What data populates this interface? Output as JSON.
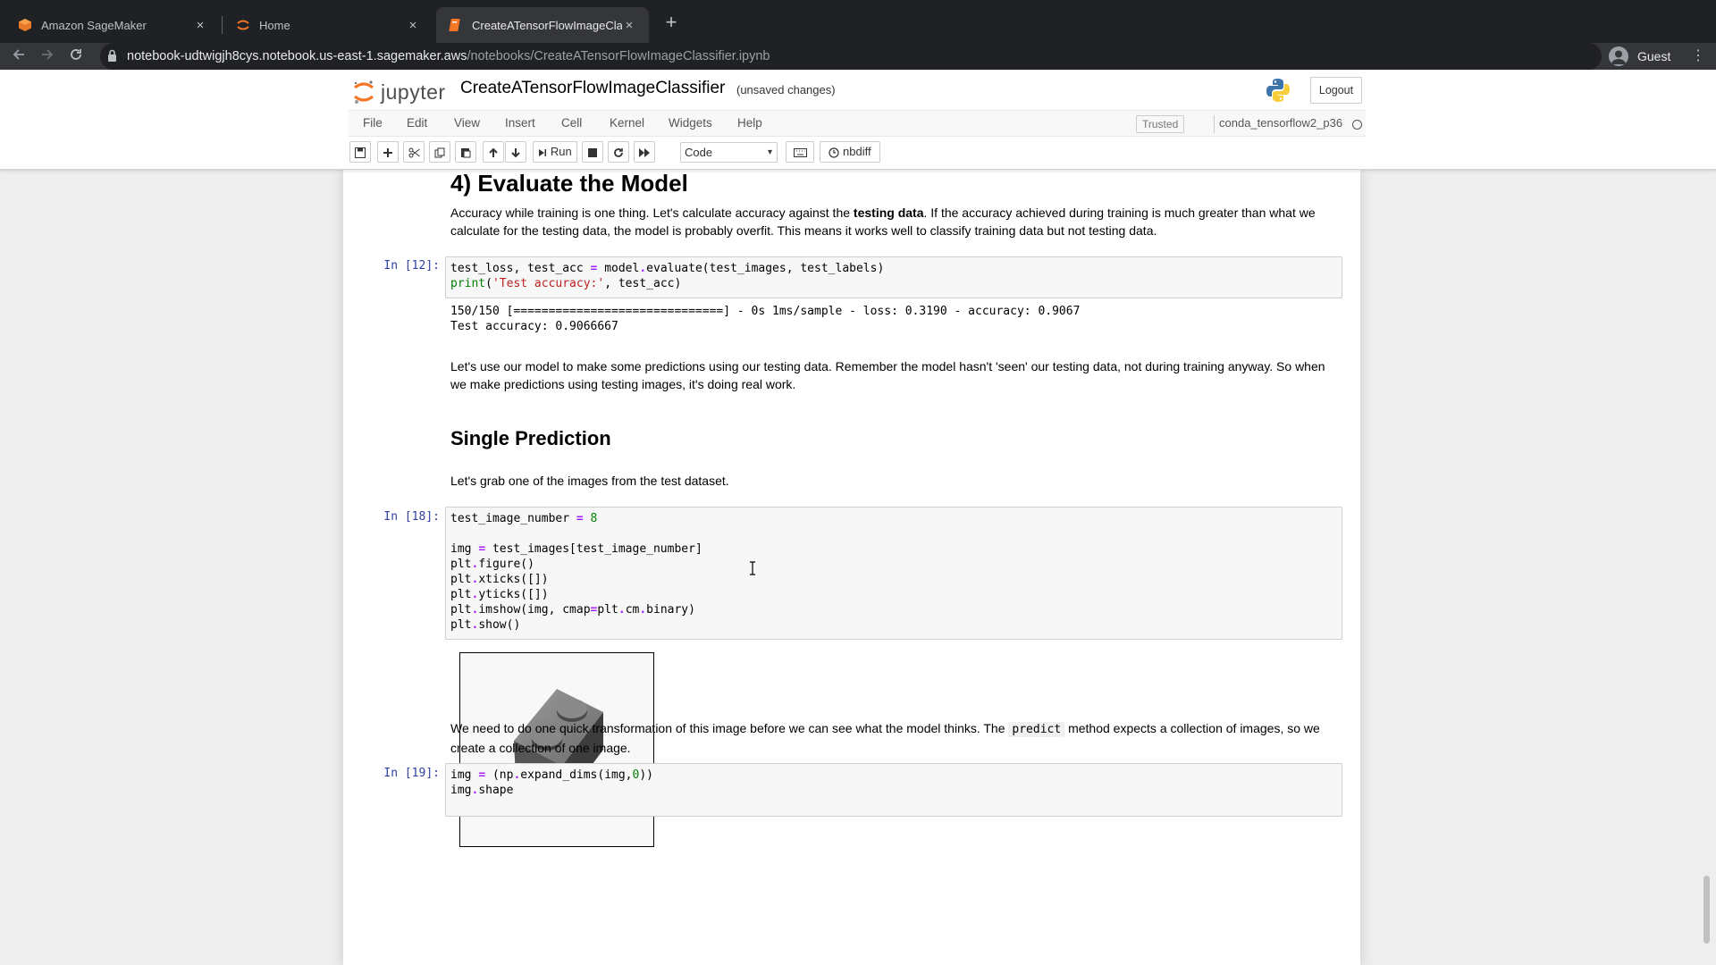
{
  "browser": {
    "tabs": [
      {
        "title": "Amazon SageMaker",
        "icon": "sagemaker-icon"
      },
      {
        "title": "Home",
        "icon": "jupyter-icon"
      },
      {
        "title": "CreateATensorFlowImageClass",
        "icon": "notebook-icon",
        "active": true
      }
    ],
    "close_glyph": "×",
    "new_tab_glyph": "+",
    "url_host": "notebook-udtwigjh8cys.notebook.us-east-1.sagemaker.aws",
    "url_path": "/notebooks/CreateATensorFlowImageClassifier.ipynb",
    "profile_label": "Guest"
  },
  "jupyter": {
    "logo_text": "jupyter",
    "notebook_name": "CreateATensorFlowImageClassifier",
    "save_status": "(unsaved changes)",
    "logout_label": "Logout",
    "menu": [
      "File",
      "Edit",
      "View",
      "Insert",
      "Cell",
      "Kernel",
      "Widgets",
      "Help"
    ],
    "trusted_label": "Trusted",
    "kernel_name": "conda_tensorflow2_p36",
    "toolbar": {
      "run_label": "Run",
      "cell_type": "Code",
      "nbdiff_label": "nbdiff"
    }
  },
  "notebook": {
    "section_heading": "4) Evaluate the Model",
    "intro_pre": "Accuracy while training is one thing. Let's calculate accuracy against the ",
    "intro_bold": "testing data",
    "intro_post": ". If the accuracy achieved during training is much greater than what we calculate for the testing data, the model is probably overfit. This means it works well to classify training data but not testing data.",
    "cell12": {
      "prompt": "In [12]:",
      "output_line1": "150/150 [==============================] - 0s 1ms/sample - loss: 0.3190 - accuracy: 0.9067",
      "output_line2": "Test accuracy: 0.9066667"
    },
    "predict_intro": "Let's use our model to make some predictions using our testing data. Remember the model hasn't 'seen' our testing data, not during training anyway. So when we make predictions using testing images, it's doing real work.",
    "single_heading": "Single Prediction",
    "grab_text": "Let's grab one of the images from the test dataset.",
    "cell18": {
      "prompt": "In [18]:"
    },
    "transform_pre": "We need to do one quick transformation of this image before we can see what the model thinks. The ",
    "transform_code": "predict",
    "transform_post": " method expects a collection of images, so we create a collection of one image.",
    "cell19": {
      "prompt": "In [19]:"
    }
  }
}
